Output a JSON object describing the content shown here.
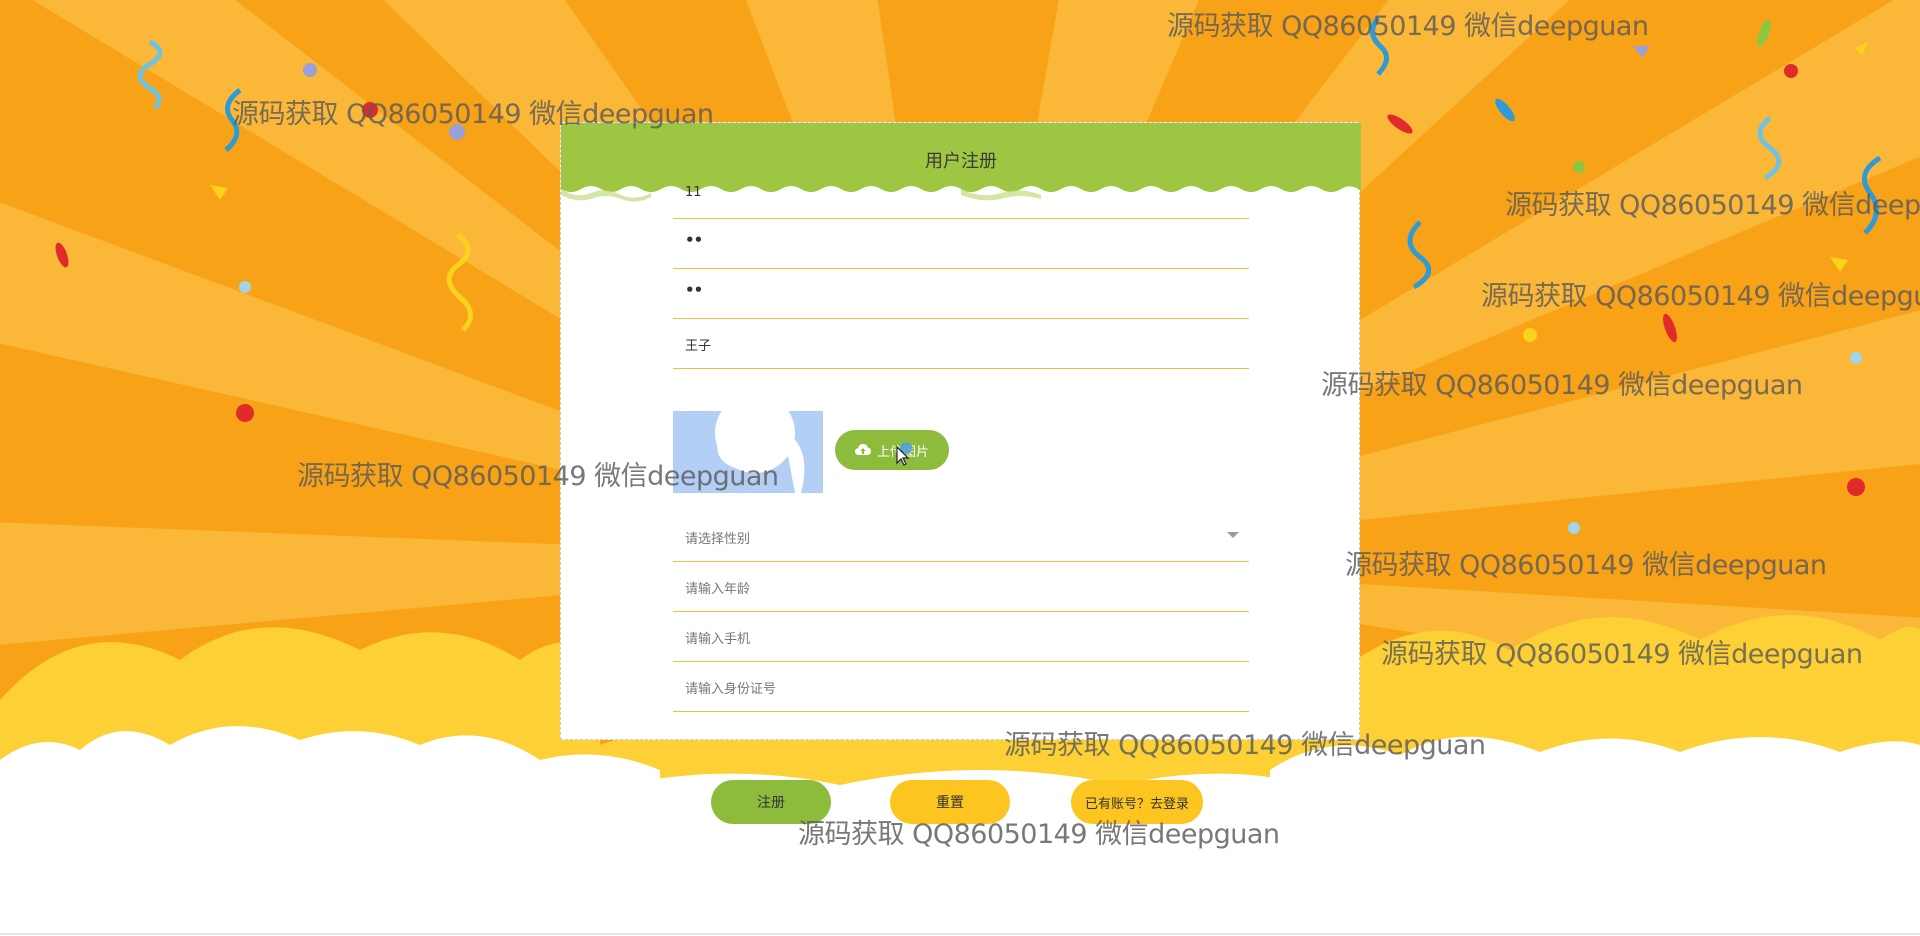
{
  "page": {
    "title": "用户注册"
  },
  "form": {
    "account": {
      "value": "11"
    },
    "password": {
      "value": "••"
    },
    "confirm_password": {
      "value": "••"
    },
    "name": {
      "value": "王子"
    },
    "upload_label": "上传图片",
    "gender": {
      "placeholder": "请选择性别"
    },
    "age": {
      "placeholder": "请输入年龄"
    },
    "phone": {
      "placeholder": "请输入手机"
    },
    "id_card": {
      "placeholder": "请输入身份证号"
    }
  },
  "actions": {
    "register_label": "注册",
    "reset_label": "重置",
    "login_label": "已有账号？去登录"
  },
  "watermark": {
    "text": "源码获取 QQ86050149 微信deepguan"
  },
  "icons": {
    "upload": "cloud-upload-icon",
    "dropdown": "chevron-down-icon",
    "cursor": "mouse-pointer-icon"
  },
  "colors": {
    "background": "#f8a217",
    "header_green": "#9ec642",
    "primary_button": "#8dbb3c",
    "secondary_button": "#fcc51f",
    "field_underline": "#f1c33a",
    "cloud": "#ffffff",
    "cloud_yellow": "#fdd036"
  }
}
